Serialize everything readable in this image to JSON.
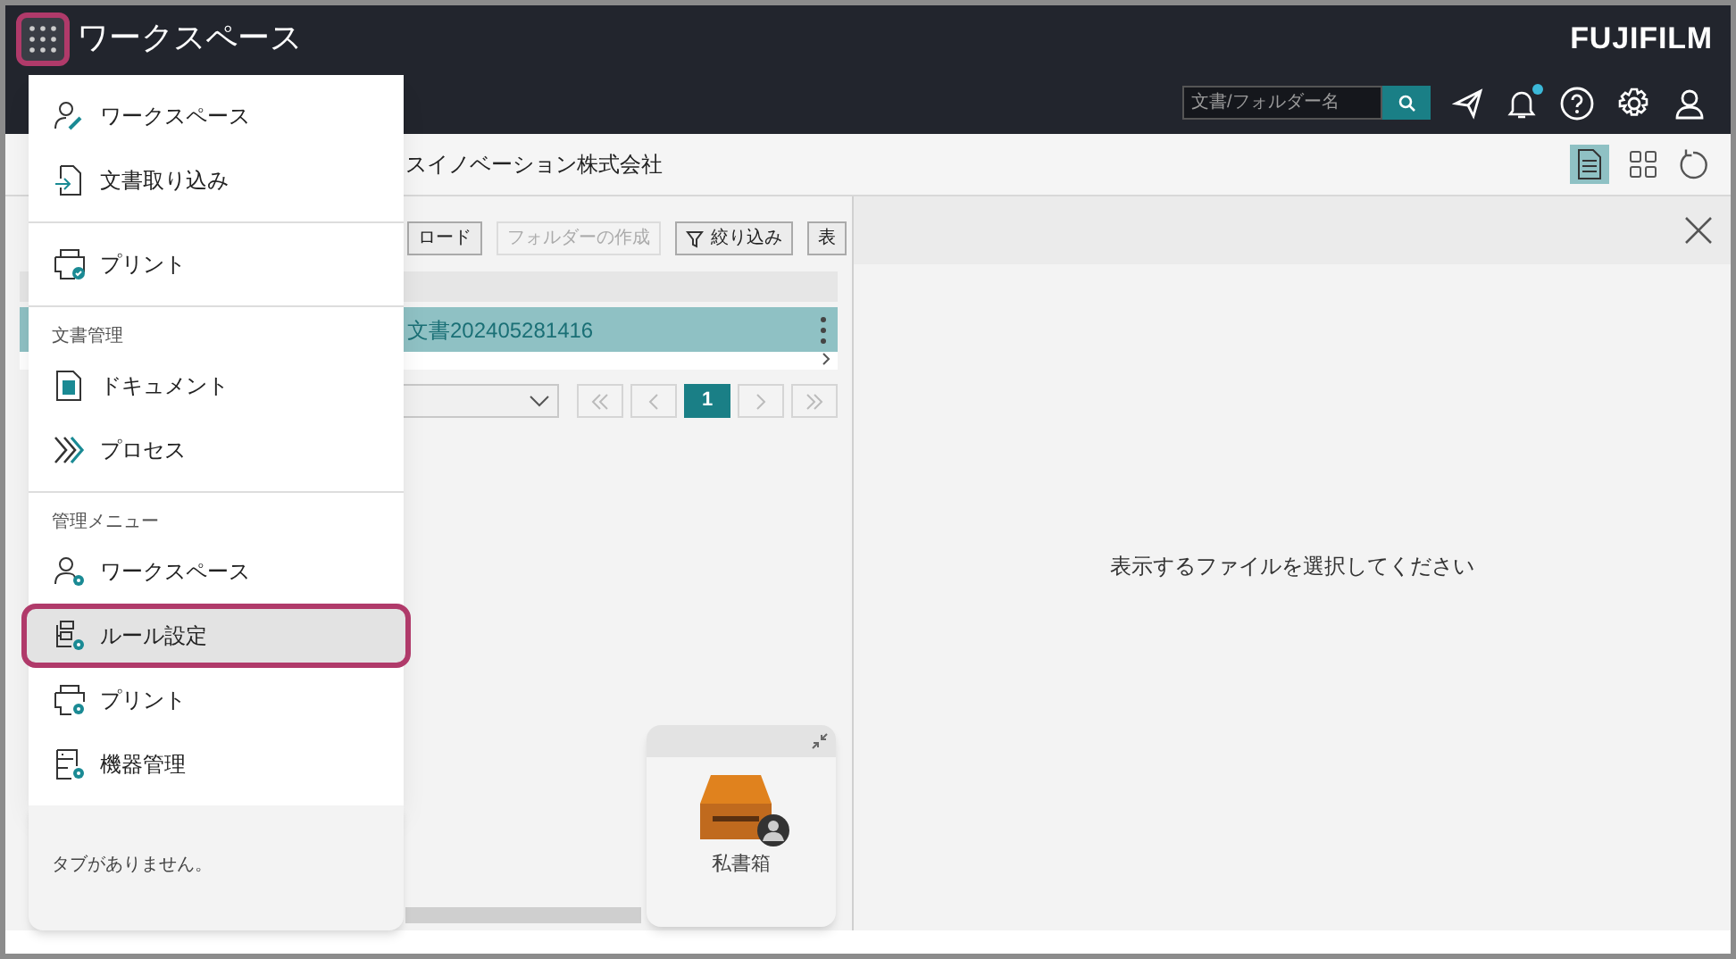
{
  "header": {
    "title": "ワークスペース",
    "menu_button": {
      "highlighted": true
    },
    "logo": "FUJIFILM",
    "search": {
      "placeholder": "文書/フォルダー名"
    },
    "has_notification": true
  },
  "toolbar": {
    "company": "スイノベーション株式会社",
    "views": [
      {
        "kind": "detail",
        "selected": true
      },
      {
        "kind": "grid",
        "selected": false
      }
    ]
  },
  "list_pane": {
    "buttons": [
      {
        "label": "ロード",
        "disabled": false,
        "kind": "plain"
      },
      {
        "label": "フォルダーの作成",
        "disabled": true,
        "kind": "plain"
      },
      {
        "label": "絞り込み",
        "disabled": false,
        "kind": "filter"
      },
      {
        "label": "表",
        "disabled": false,
        "kind": "plain"
      }
    ],
    "rows": [
      {
        "name": "文書202405281416",
        "selected": true
      }
    ],
    "pagination": {
      "pages": [
        {
          "label": "1",
          "selected": true
        }
      ]
    }
  },
  "preview": {
    "message": "表示するファイルを選択してください"
  },
  "app_menu": {
    "sections": [
      {
        "items": [
          {
            "label": "ワークスペース",
            "kind": "workspace",
            "highlighted": false
          },
          {
            "label": "文書取り込み",
            "kind": "import",
            "highlighted": false
          }
        ]
      },
      {
        "items": [
          {
            "label": "プリント",
            "kind": "print",
            "highlighted": false
          }
        ]
      },
      {
        "heading": "文書管理",
        "items": [
          {
            "label": "ドキュメント",
            "kind": "document",
            "highlighted": false
          },
          {
            "label": "プロセス",
            "kind": "process",
            "highlighted": false
          }
        ]
      },
      {
        "heading": "管理メニュー",
        "items": [
          {
            "label": "ワークスペース",
            "kind": "workspace_admin",
            "highlighted": false
          },
          {
            "label": "ルール設定",
            "kind": "rule",
            "highlighted": true
          },
          {
            "label": "プリント",
            "kind": "print_admin",
            "highlighted": false
          },
          {
            "label": "機器管理",
            "kind": "device",
            "highlighted": false
          }
        ]
      }
    ],
    "empty_tabs": "タブがありません。"
  },
  "mailbox_widget": {
    "label": "私書箱"
  }
}
